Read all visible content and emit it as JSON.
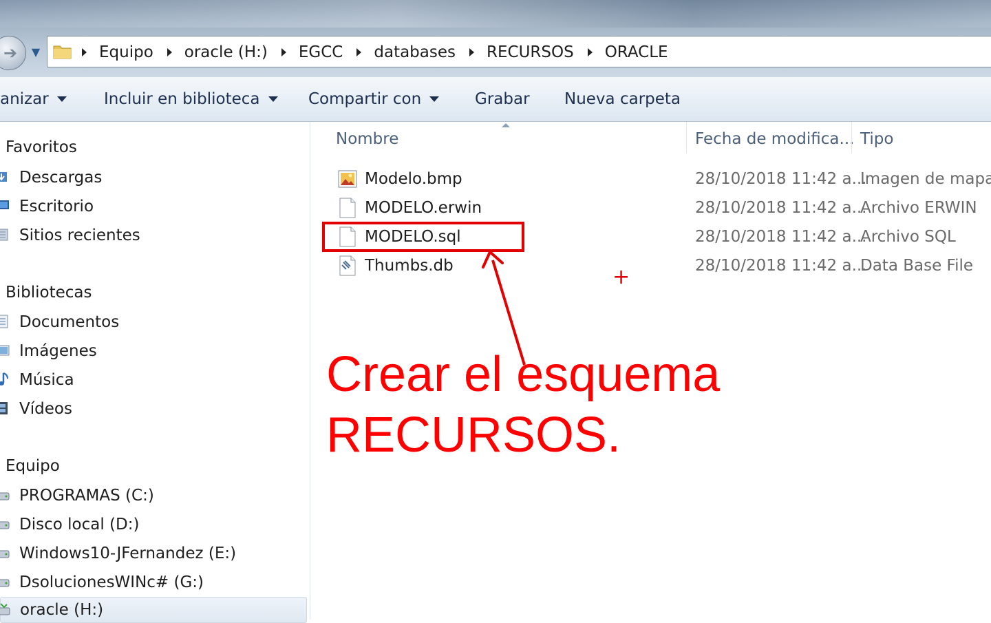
{
  "address_bar": {
    "breadcrumbs": [
      "Equipo",
      "oracle (H:)",
      "EGCC",
      "databases",
      "RECURSOS",
      "ORACLE"
    ]
  },
  "toolbar": {
    "organize": "anizar",
    "include_library": "Incluir en biblioteca",
    "share_with": "Compartir con",
    "burn": "Grabar",
    "new_folder": "Nueva carpeta"
  },
  "nav_pane": {
    "favorites": {
      "header": "Favoritos",
      "items": [
        "Descargas",
        "Escritorio",
        "Sitios recientes"
      ]
    },
    "libraries": {
      "header": "Bibliotecas",
      "items": [
        "Documentos",
        "Imágenes",
        "Música",
        "Vídeos"
      ]
    },
    "computer": {
      "header": "Equipo",
      "items": [
        "PROGRAMAS (C:)",
        "Disco local (D:)",
        "Windows10-JFernandez (E:)",
        "DsolucionesWINc# (G:)",
        "oracle (H:)"
      ]
    }
  },
  "file_list": {
    "columns": {
      "name": "Nombre",
      "date": "Fecha de modifica...",
      "type": "Tipo"
    },
    "files": [
      {
        "name": "Modelo.bmp",
        "date": "28/10/2018 11:42 a...",
        "type": "Imagen de mapa ...",
        "icon": "bitmap-image-icon"
      },
      {
        "name": "MODELO.erwin",
        "date": "28/10/2018 11:42 a...",
        "type": "Archivo ERWIN",
        "icon": "generic-file-icon"
      },
      {
        "name": "MODELO.sql",
        "date": "28/10/2018 11:42 a...",
        "type": "Archivo SQL",
        "icon": "generic-file-icon"
      },
      {
        "name": "Thumbs.db",
        "date": "28/10/2018 11:42 a...",
        "type": "Data Base File",
        "icon": "database-file-icon"
      }
    ]
  },
  "annotation": {
    "line1": "Crear el esquema",
    "line2": "RECURSOS.",
    "plus": "+",
    "color": "#ff0000"
  }
}
